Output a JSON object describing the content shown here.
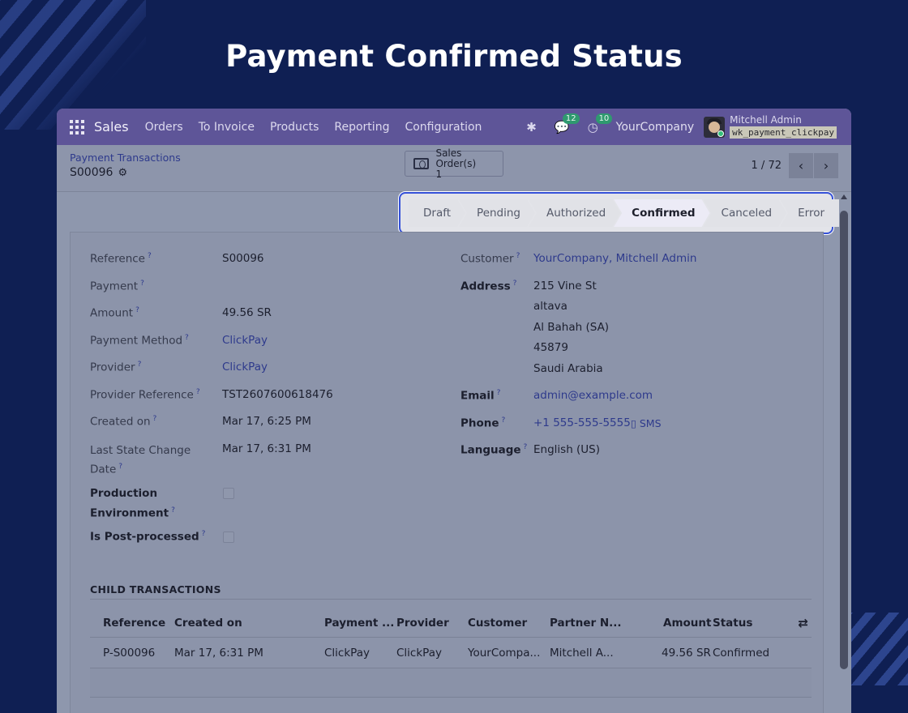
{
  "page_title": "Payment Confirmed Status",
  "navbar": {
    "brand": "Sales",
    "items": [
      "Orders",
      "To Invoice",
      "Products",
      "Reporting",
      "Configuration"
    ],
    "messages_count": "12",
    "activities_count": "10",
    "company": "YourCompany",
    "user_name": "Mitchell Admin",
    "database": "wk_payment_clickpay"
  },
  "control": {
    "breadcrumb": "Payment Transactions",
    "record_name": "S00096",
    "smart_button": {
      "label": "Sales Order(s)",
      "count": "1"
    },
    "pager": "1 / 72"
  },
  "statusbar": {
    "stages": [
      "Draft",
      "Pending",
      "Authorized",
      "Confirmed",
      "Canceled",
      "Error"
    ],
    "active": "Confirmed"
  },
  "form_left": {
    "reference_label": "Reference",
    "reference": "S00096",
    "payment_label": "Payment",
    "amount_label": "Amount",
    "amount": "49.56 SR",
    "payment_method_label": "Payment Method",
    "payment_method": "ClickPay",
    "provider_label": "Provider",
    "provider": "ClickPay",
    "provider_reference_label": "Provider Reference",
    "provider_reference": "TST2607600618476",
    "created_on_label": "Created on",
    "created_on": "Mar 17, 6:25 PM",
    "last_state_label_1": "Last State Change",
    "last_state_label_2": "Date",
    "last_state": "Mar 17, 6:31 PM",
    "production_label_1": "Production",
    "production_label_2": "Environment",
    "post_processed_label": "Is Post-processed"
  },
  "form_right": {
    "customer_label": "Customer",
    "customer": "YourCompany, Mitchell Admin",
    "address_label": "Address",
    "address_lines": [
      "215 Vine St",
      "altava",
      "Al Bahah (SA)",
      "45879",
      "Saudi Arabia"
    ],
    "email_label": "Email",
    "email": "admin@example.com",
    "phone_label": "Phone",
    "phone": "+1 555-555-5555",
    "sms": "SMS",
    "language_label": "Language",
    "language": "English (US)"
  },
  "child_transactions": {
    "title": "CHILD TRANSACTIONS",
    "headers": [
      "Reference",
      "Created on",
      "Payment ...",
      "Provider",
      "Customer",
      "Partner N...",
      "Amount",
      "Status"
    ],
    "rows": [
      [
        "P-S00096",
        "Mar 17, 6:31 PM",
        "ClickPay",
        "ClickPay",
        "YourCompa...",
        "Mitchell A...",
        "49.56 SR",
        "Confirmed"
      ]
    ]
  }
}
